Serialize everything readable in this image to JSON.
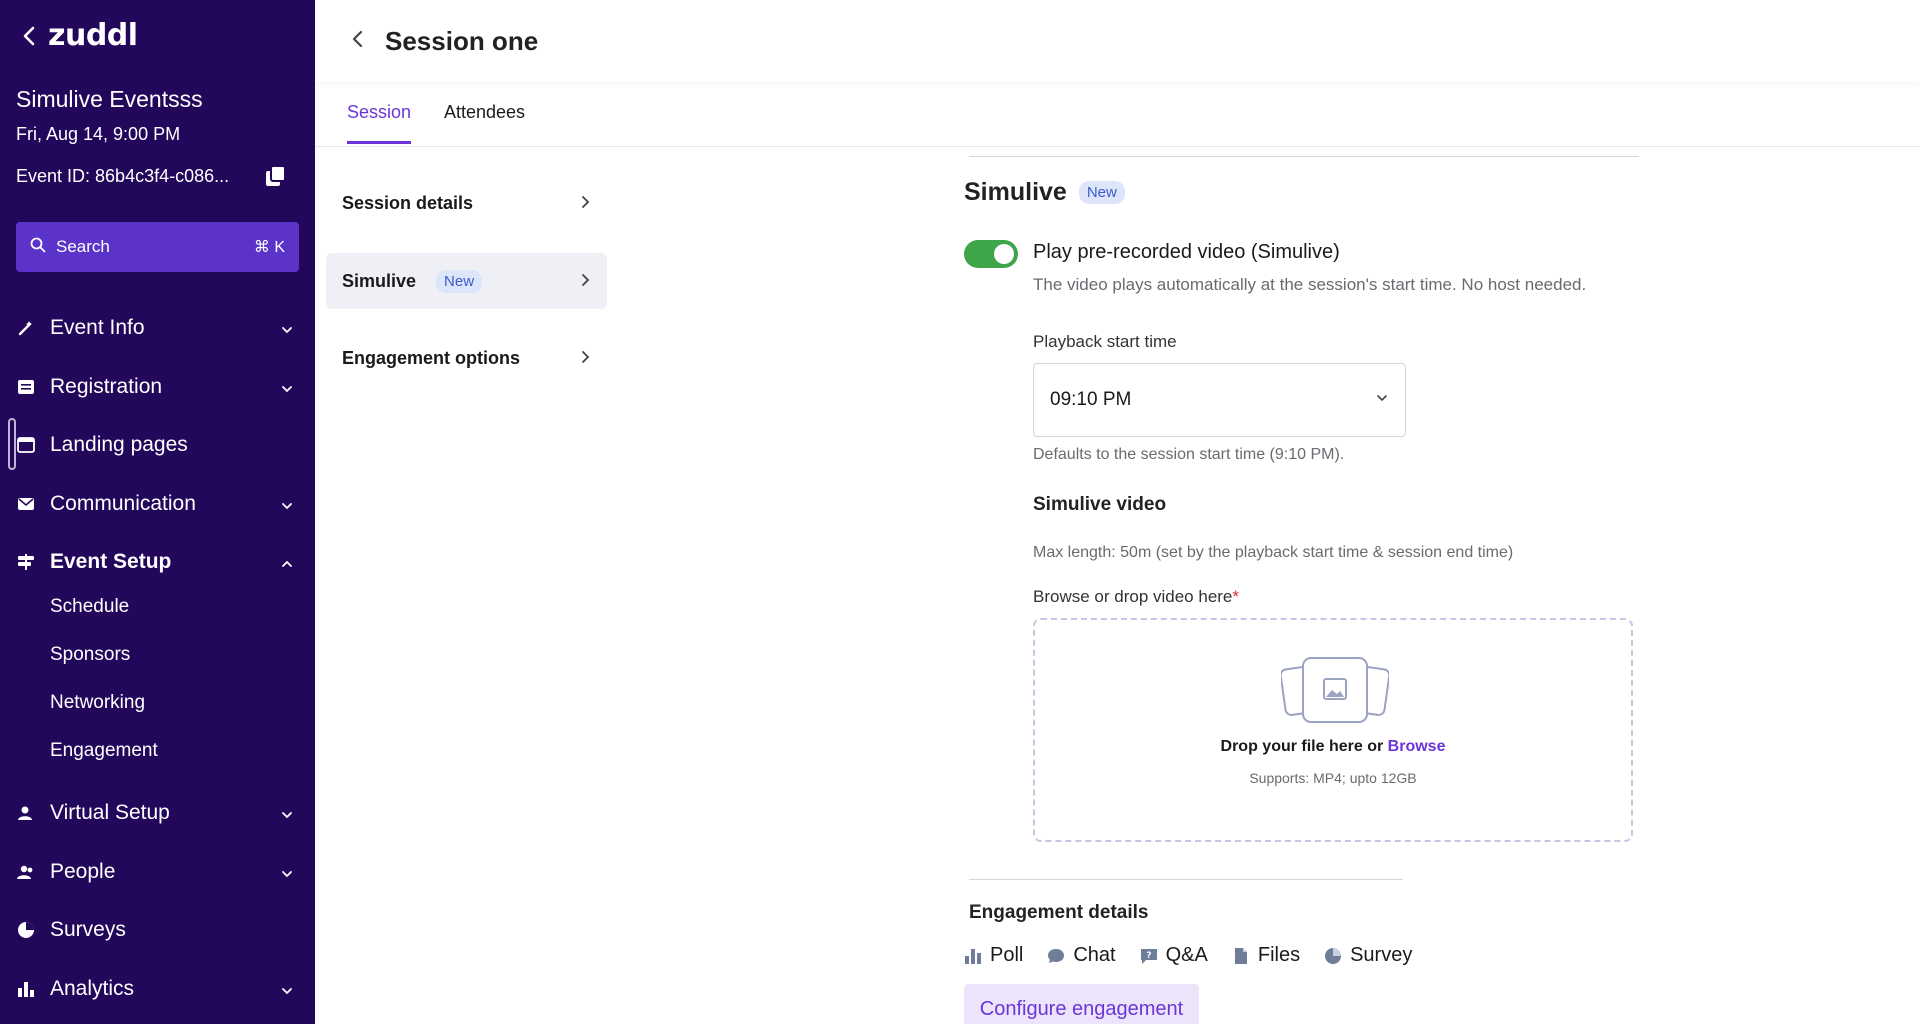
{
  "app": {
    "logo": "zuddl"
  },
  "event": {
    "name": "Simulive Eventsss",
    "date": "Fri, Aug 14, 9:00 PM",
    "id_label": "Event ID: 86b4c3f4-c086..."
  },
  "search": {
    "label": "Search",
    "shortcut": "⌘ K"
  },
  "sidebar": {
    "items": [
      {
        "label": "Event Info",
        "icon": "magic-wand-icon"
      },
      {
        "label": "Registration",
        "icon": "form-icon"
      },
      {
        "label": "Landing pages",
        "icon": "browser-icon"
      },
      {
        "label": "Communication",
        "icon": "mail-icon"
      },
      {
        "label": "Event Setup",
        "icon": "signpost-icon"
      },
      {
        "label": "Virtual Setup",
        "icon": "person-icon"
      },
      {
        "label": "People",
        "icon": "people-icon"
      },
      {
        "label": "Surveys",
        "icon": "pie-chart-icon"
      },
      {
        "label": "Analytics",
        "icon": "bar-chart-icon"
      }
    ],
    "event_setup_sub": [
      "Schedule",
      "Sponsors",
      "Networking",
      "Engagement"
    ]
  },
  "header": {
    "title": "Session one"
  },
  "tabs": [
    {
      "label": "Session",
      "active": true
    },
    {
      "label": "Attendees",
      "active": false
    }
  ],
  "subnav": {
    "items": [
      {
        "label": "Session details"
      },
      {
        "label": "Simulive",
        "badge": "New"
      },
      {
        "label": "Engagement options"
      }
    ]
  },
  "simulive": {
    "title": "Simulive",
    "badge": "New",
    "toggle_label": "Play pre-recorded video (Simulive)",
    "toggle_on": true,
    "toggle_desc": "The video plays automatically at the session's start time. No host needed.",
    "playback_label": "Playback start time",
    "playback_value": "09:10 PM",
    "playback_hint": "Defaults to the session start time (9:10 PM).",
    "video_heading": "Simulive video",
    "max_length": "Max length: 50m (set by the playback start time & session end time)",
    "browse_label": "Browse or drop video here",
    "required_mark": "*",
    "drop_text": "Drop your file here or",
    "browse_link": "Browse",
    "supports": "Supports: MP4; upto 12GB"
  },
  "engagement": {
    "title": "Engagement details",
    "items": [
      {
        "label": "Poll",
        "icon": "bar-chart-icon"
      },
      {
        "label": "Chat",
        "icon": "chat-bubble-icon"
      },
      {
        "label": "Q&A",
        "icon": "question-icon"
      },
      {
        "label": "Files",
        "icon": "file-icon"
      },
      {
        "label": "Survey",
        "icon": "pie-chart-icon"
      }
    ],
    "configure_label": "Configure engagement"
  },
  "colors": {
    "sidebar_bg": "#23075a",
    "accent": "#6b35d9",
    "toggle_on": "#3ea54a",
    "search_bg": "#5b33c8"
  }
}
